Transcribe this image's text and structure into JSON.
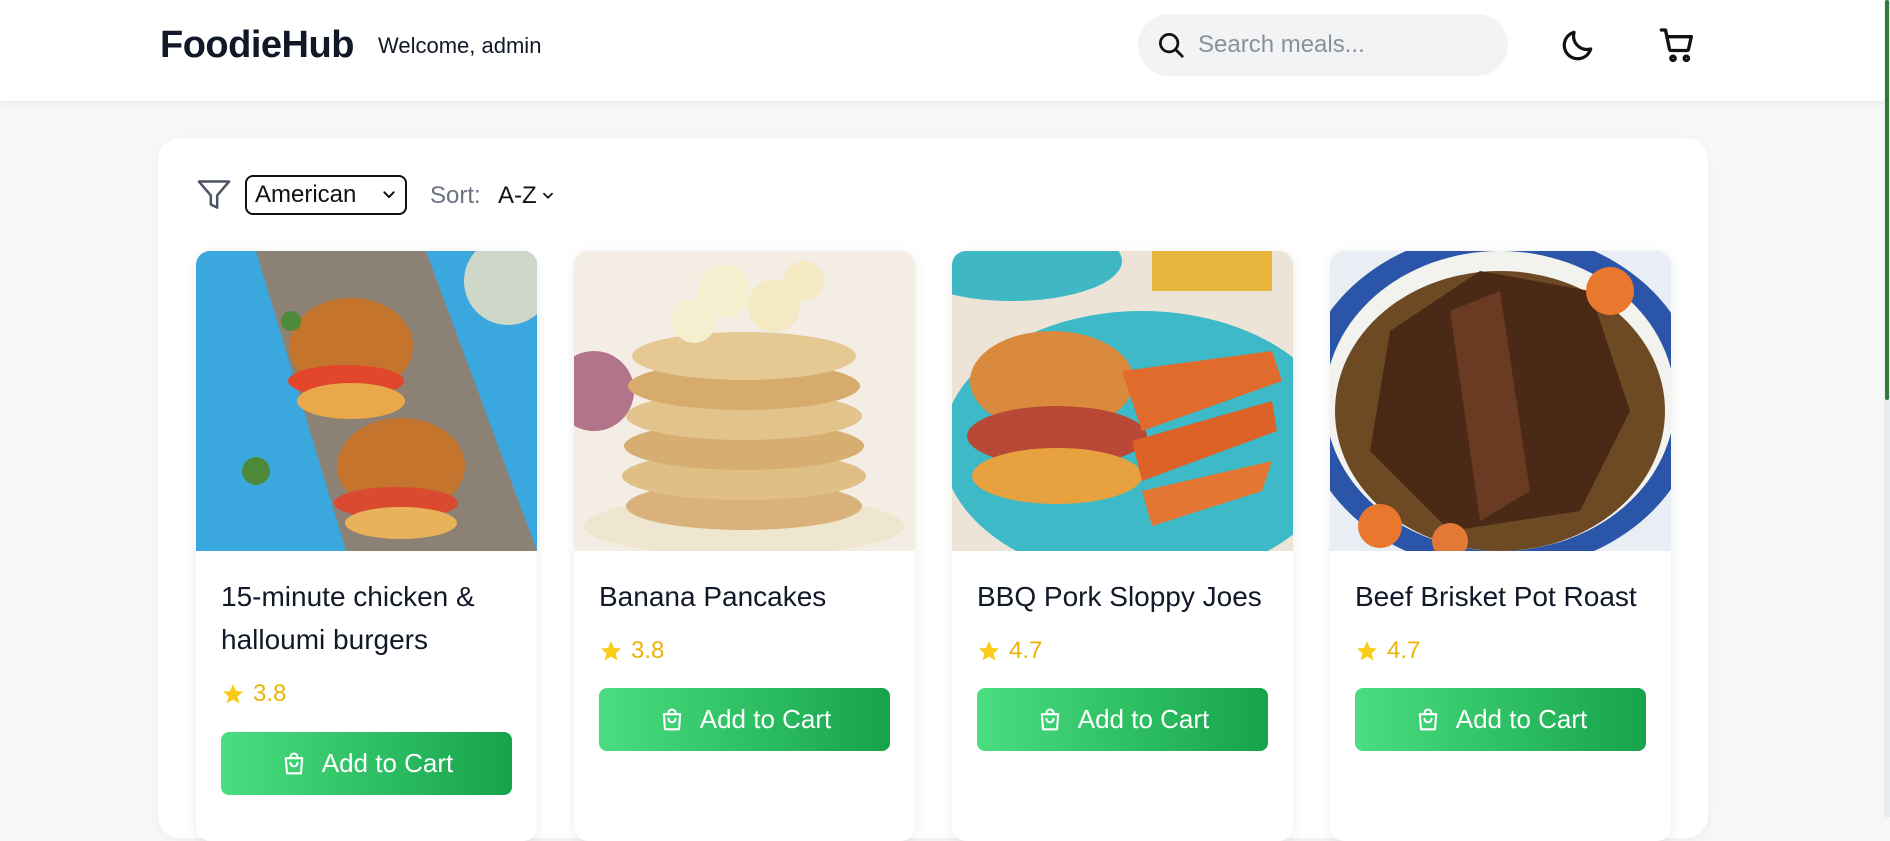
{
  "header": {
    "brand": "FoodieHub",
    "welcome": "Welcome, admin",
    "search_placeholder": "Search meals..."
  },
  "filters": {
    "cuisine_selected": "American",
    "sort_label": "Sort:",
    "sort_selected": "A-Z"
  },
  "meals": [
    {
      "name": "15-minute chicken & halloumi burgers",
      "rating": "3.8",
      "button": "Add to Cart"
    },
    {
      "name": "Banana Pancakes",
      "rating": "3.8",
      "button": "Add to Cart"
    },
    {
      "name": "BBQ Pork Sloppy Joes",
      "rating": "4.7",
      "button": "Add to Cart"
    },
    {
      "name": "Beef Brisket Pot Roast",
      "rating": "4.7",
      "button": "Add to Cart"
    }
  ],
  "colors": {
    "accent_green_start": "#4ade80",
    "accent_green_end": "#16a34a",
    "rating_yellow": "#eab308",
    "scrollbar": "#2e7d32"
  },
  "icons": [
    "search-icon",
    "moon-icon",
    "cart-icon",
    "filter-icon",
    "chevron-down-icon",
    "star-icon",
    "shopping-bag-icon"
  ]
}
